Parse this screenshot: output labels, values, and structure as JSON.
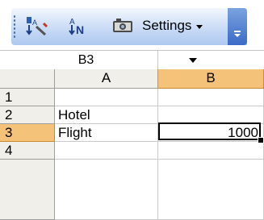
{
  "toolbar": {
    "buttons": [
      {
        "name": "sort-clear-icon",
        "icon": "sort-icon"
      },
      {
        "name": "sort-az-icon",
        "icon": "sort-az-icon"
      },
      {
        "name": "camera-icon",
        "icon": "camera-icon"
      }
    ],
    "settings_label": "Settings",
    "colors": {
      "bar_top": "#f3f7fd",
      "bar_bottom": "#aec8ef",
      "chevron": "#3c6ac6"
    }
  },
  "namebox": {
    "value": "B3"
  },
  "grid": {
    "column_headers": [
      "A",
      "B"
    ],
    "selected_column": "B",
    "selected_row": "3",
    "rows": [
      {
        "number": "",
        "a": "",
        "b": ""
      },
      {
        "number": "1",
        "a": "",
        "b": ""
      },
      {
        "number": "2",
        "a": "Hotel",
        "b": ""
      },
      {
        "number": "3",
        "a": "Flight",
        "b": "1000"
      },
      {
        "number": "4",
        "a": "",
        "b": ""
      }
    ],
    "header_color": "#f0efea",
    "selected_header_color": "#f5c27a"
  }
}
